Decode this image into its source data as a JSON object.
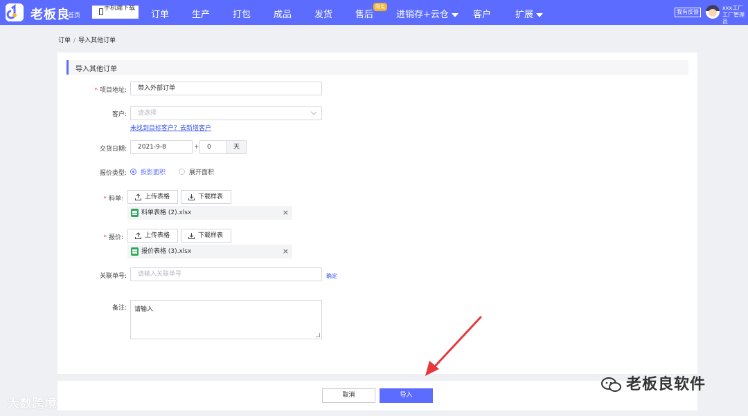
{
  "topbar": {
    "brand": "老板良",
    "home": "首页",
    "download_label": "手机端下载",
    "nav": [
      {
        "label": "订单"
      },
      {
        "label": "生产"
      },
      {
        "label": "打包"
      },
      {
        "label": "成品"
      },
      {
        "label": "发货"
      },
      {
        "label": "售后"
      },
      {
        "label": "进销存+云仓"
      },
      {
        "label": "客户"
      },
      {
        "label": "扩展"
      }
    ],
    "badge": "限免",
    "feedback": "我有反馈",
    "user_line1": "xxx工厂",
    "user_line2": "工厂管理员",
    "accent_color": "#5b6cff"
  },
  "breadcrumb": [
    "订单",
    "导入其他订单"
  ],
  "breadcrumb_sep": "/",
  "section_title": "导入其他订单",
  "form": {
    "project_label": "项目地址:",
    "project_value": "带入外部订单",
    "customer_label": "客户:",
    "customer_placeholder": "请选择",
    "customer_link": "未找到目标客户？去新增客户",
    "delivery_label": "交货日期:",
    "delivery_date": "2021-9-8",
    "plus": "+",
    "delivery_days": "0",
    "days_unit": "天",
    "quote_type_label": "报价类型:",
    "quote_options": [
      "投影面积",
      "展开面积"
    ],
    "material_label": "料单:",
    "upload_label": "上传表格",
    "download_sample_label": "下载样表",
    "material_file": "料单表格 (2).xlsx",
    "price_label": "报价:",
    "price_file": "报价表格 (3).xlsx",
    "link_no_label": "关联单号:",
    "link_no_placeholder": "请输入关联单号",
    "confirm_label": "确定",
    "remark_label": "备注:",
    "remark_placeholder": "请输入"
  },
  "footer": {
    "cancel": "取消",
    "import": "导入"
  },
  "watermark_right": "老板良软件",
  "watermark_left": "大数跨境"
}
